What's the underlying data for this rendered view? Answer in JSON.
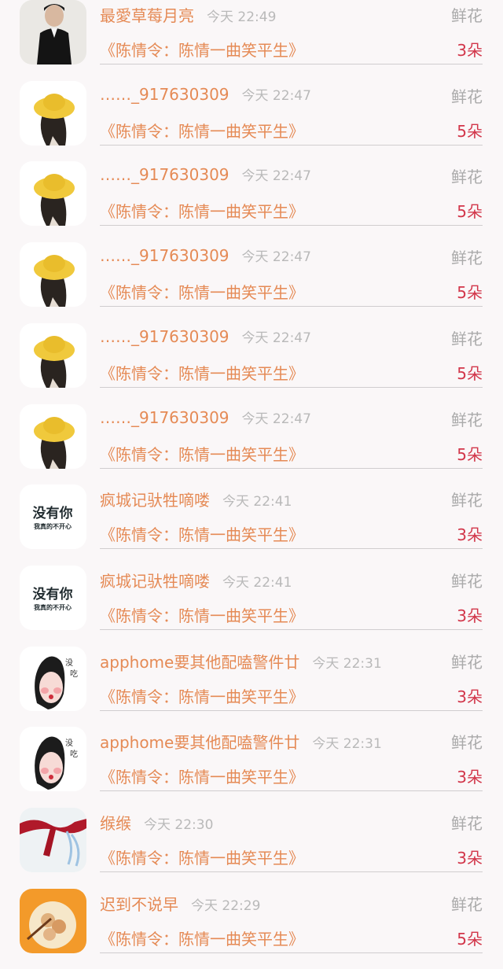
{
  "gift_list": {
    "items": [
      {
        "user": "最愛草莓月亮",
        "time": "今天 22:49",
        "gift_type": "鲜花",
        "title": "《陈情令：陈情一曲笑平生》",
        "count": "3朵",
        "avatar_icon": "man-in-suit-avatar-icon"
      },
      {
        "user": "……_917630309",
        "time": "今天 22:47",
        "gift_type": "鲜花",
        "title": "《陈情令：陈情一曲笑平生》",
        "count": "5朵",
        "avatar_icon": "yellow-hat-girl-avatar-icon"
      },
      {
        "user": "……_917630309",
        "time": "今天 22:47",
        "gift_type": "鲜花",
        "title": "《陈情令：陈情一曲笑平生》",
        "count": "5朵",
        "avatar_icon": "yellow-hat-girl-avatar-icon"
      },
      {
        "user": "……_917630309",
        "time": "今天 22:47",
        "gift_type": "鲜花",
        "title": "《陈情令：陈情一曲笑平生》",
        "count": "5朵",
        "avatar_icon": "yellow-hat-girl-avatar-icon"
      },
      {
        "user": "……_917630309",
        "time": "今天 22:47",
        "gift_type": "鲜花",
        "title": "《陈情令：陈情一曲笑平生》",
        "count": "5朵",
        "avatar_icon": "yellow-hat-girl-avatar-icon"
      },
      {
        "user": "……_917630309",
        "time": "今天 22:47",
        "gift_type": "鲜花",
        "title": "《陈情令：陈情一曲笑平生》",
        "count": "5朵",
        "avatar_icon": "yellow-hat-girl-avatar-icon"
      },
      {
        "user": "疯城记驮牲嘀喽",
        "time": "今天 22:41",
        "gift_type": "鲜花",
        "title": "《陈情令：陈情一曲笑平生》",
        "count": "3朵",
        "avatar_icon": "text-avatar-icon",
        "avatar_text": "没有你",
        "avatar_subtext": "我真的不开心"
      },
      {
        "user": "疯城记驮牲嘀喽",
        "time": "今天 22:41",
        "gift_type": "鲜花",
        "title": "《陈情令：陈情一曲笑平生》",
        "count": "3朵",
        "avatar_icon": "text-avatar-icon",
        "avatar_text": "没有你",
        "avatar_subtext": "我真的不开心"
      },
      {
        "user": "apphome要其他配嗑警件廿",
        "time": "今天 22:31",
        "gift_type": "鲜花",
        "title": "《陈情令：陈情一曲笑平生》",
        "count": "3朵",
        "avatar_icon": "cartoon-face-avatar-icon"
      },
      {
        "user": "apphome要其他配嗑警件廿",
        "time": "今天 22:31",
        "gift_type": "鲜花",
        "title": "《陈情令：陈情一曲笑平生》",
        "count": "3朵",
        "avatar_icon": "cartoon-face-avatar-icon"
      },
      {
        "user": "缑缑",
        "time": "今天 22:30",
        "gift_type": "鲜花",
        "title": "《陈情令：陈情一曲笑平生》",
        "count": "3朵",
        "avatar_icon": "ribbon-avatar-icon"
      },
      {
        "user": "迟到不说早",
        "time": "今天 22:29",
        "gift_type": "鲜花",
        "title": "《陈情令：陈情一曲笑平生》",
        "count": "5朵",
        "avatar_icon": "food-plate-avatar-icon"
      }
    ]
  },
  "colors": {
    "background": "#faf7f8",
    "accent_orange": "#e58a55",
    "count_red": "#d2364a",
    "muted_gray": "#aaaaaa"
  }
}
